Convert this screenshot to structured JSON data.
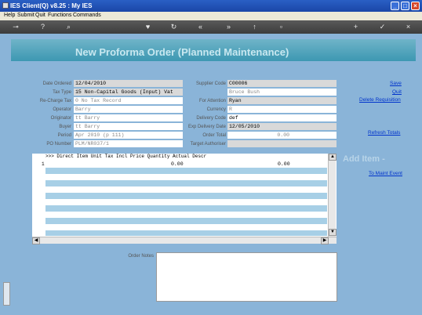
{
  "window": {
    "title": "IES Client(Q) v8.25 : My IES"
  },
  "menu": [
    "Help",
    "Submit",
    "Quit",
    "Functions",
    "Commands"
  ],
  "toolbar_icons": [
    "key-icon",
    "help-icon",
    "search-icon",
    "heart-icon",
    "refresh-icon",
    "rewind-icon",
    "forward-icon",
    "cursor-icon",
    "page-icon",
    "add-icon",
    "check-icon",
    "close-icon"
  ],
  "header": {
    "title": "New Proforma Order (Planned Maintenance)"
  },
  "left_fields": [
    {
      "label": "Date Ordered",
      "value": "12/04/2010",
      "style": "gray"
    },
    {
      "label": "Tax Type",
      "value": "15 Non-Capital Goods (Input) Vat",
      "style": "gray"
    },
    {
      "label": "Re-Charge Tax",
      "value": "0 No Tax Record",
      "style": "ro"
    },
    {
      "label": "Operator",
      "value": "Barry",
      "style": "ro"
    },
    {
      "label": "Originator",
      "value": "tt Barry",
      "style": "ro"
    },
    {
      "label": "Buyer",
      "value": "tt Barry",
      "style": "ro"
    },
    {
      "label": "Period",
      "value": "Apr 2010 (p 111)",
      "style": "ro"
    },
    {
      "label": "PO Number",
      "value": "PLM/NR037/1",
      "style": "ro"
    }
  ],
  "right_fields": [
    {
      "label": "Supplier Code",
      "value": "C00006",
      "style": "gray"
    },
    {
      "label": "",
      "value": "Bruce Bush",
      "style": "ro"
    },
    {
      "label": "For Attention",
      "value": "Ryan",
      "style": "gray"
    },
    {
      "label": "Currency",
      "value": "R",
      "style": "ro"
    },
    {
      "label": "Delivery Code",
      "value": "def",
      "style": ""
    },
    {
      "label": "Exp Delivery Date",
      "value": "12/05/2010",
      "style": "gray"
    },
    {
      "label": "Order Total",
      "value": "0.00",
      "style": "ro"
    },
    {
      "label": "Target Authoriser",
      "value": "",
      "style": "gray"
    }
  ],
  "links": {
    "save": "Save",
    "quit": "Quit",
    "delete": "Delete Requisition",
    "refresh": "Refresh Totals",
    "maint": "To Maint Event"
  },
  "grid": {
    "header": ">>> Direct Item  Unit  Tax Incl Price        Quantity    Actual              Descr",
    "row_number": "1",
    "price": "0.00",
    "actual": "0.00"
  },
  "add_item_label": "Add Item -",
  "notes_label": "Order Notes"
}
